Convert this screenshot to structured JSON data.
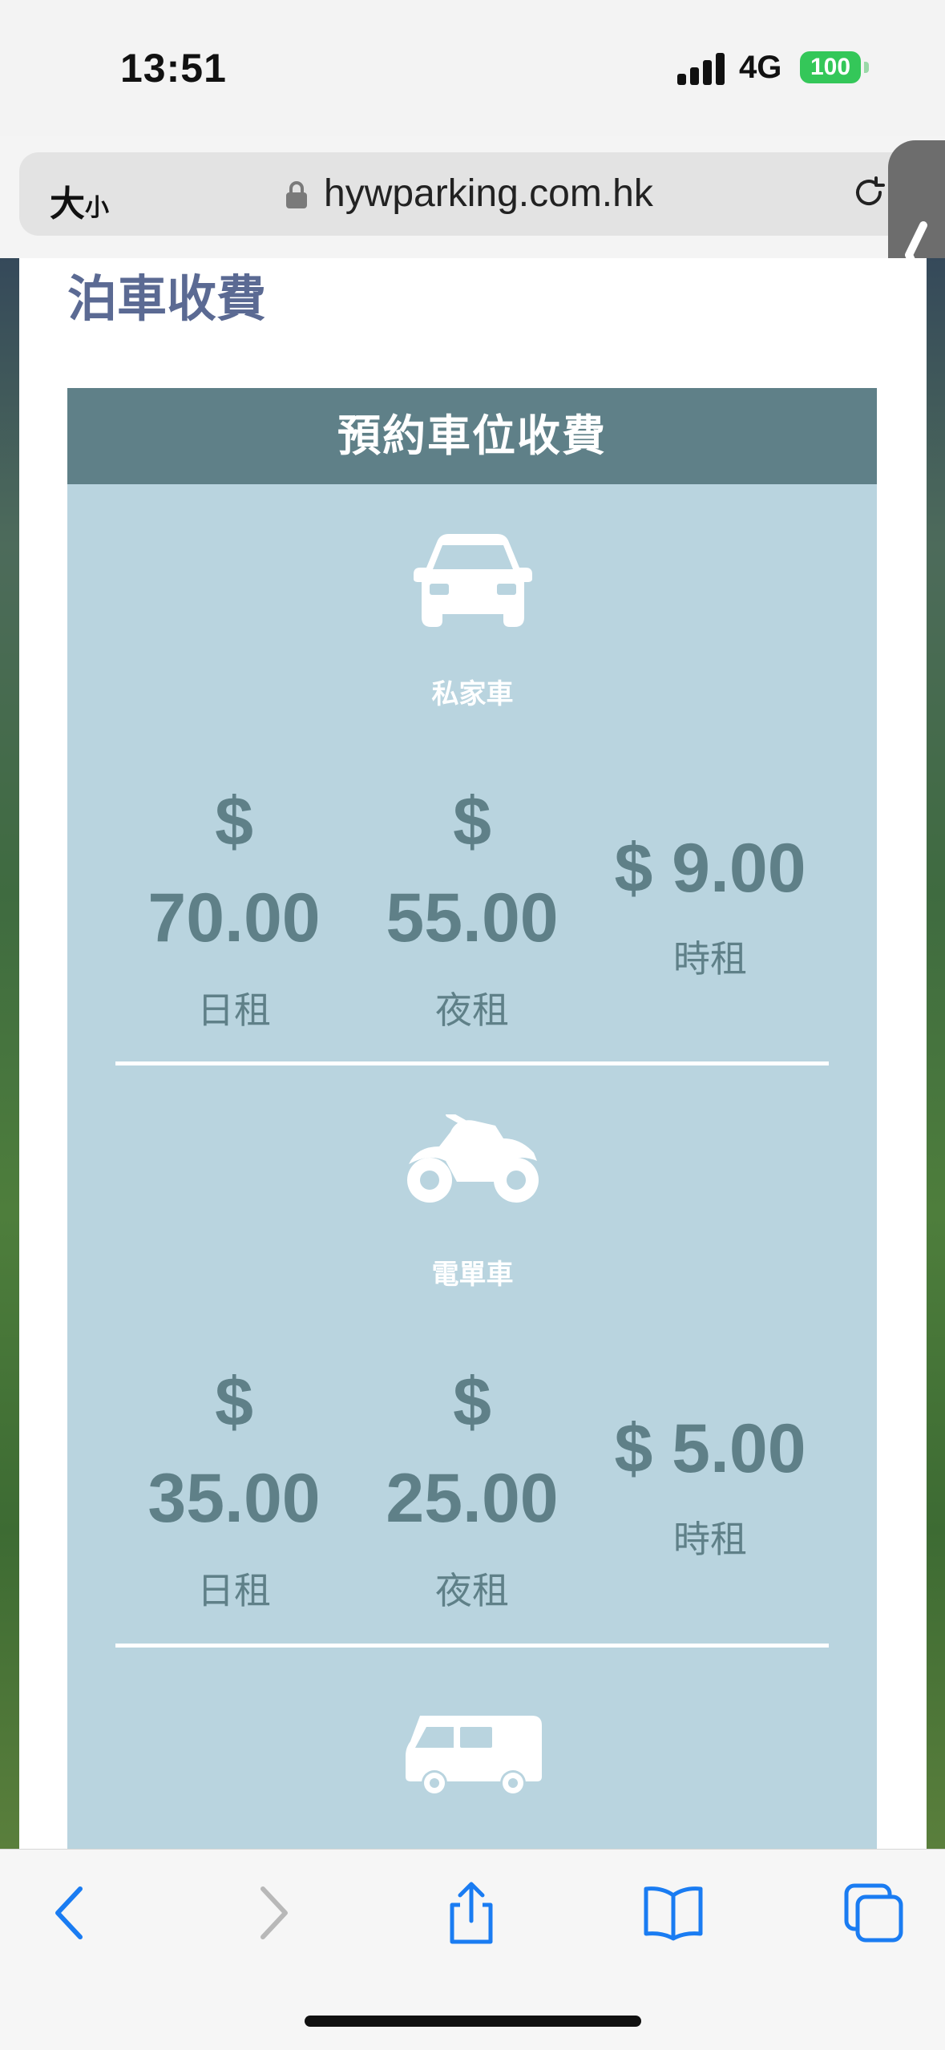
{
  "status_bar": {
    "time": "13:51",
    "network": "4G",
    "battery": "100"
  },
  "browser": {
    "text_size": "大",
    "text_size_small": "小",
    "url": "hywparking.com.hk"
  },
  "page": {
    "title": "泊車收費",
    "card_header": "預約車位收費",
    "vehicles": [
      {
        "name": "私家車",
        "icon": "car-icon",
        "day": {
          "symbol": "$",
          "amount": "70.00",
          "label": "日租"
        },
        "night": {
          "symbol": "$",
          "amount": "55.00",
          "label": "夜租"
        },
        "hourly": {
          "amount": "$ 9.00",
          "label": "時租"
        }
      },
      {
        "name": "電單車",
        "icon": "motorcycle-icon",
        "day": {
          "symbol": "$",
          "amount": "35.00",
          "label": "日租"
        },
        "night": {
          "symbol": "$",
          "amount": "25.00",
          "label": "夜租"
        },
        "hourly": {
          "amount": "$ 5.00",
          "label": "時租"
        }
      },
      {
        "icon": "van-icon"
      }
    ]
  },
  "colors": {
    "accent": "#5f8088",
    "card_bg": "#b9d4df",
    "title": "#5b6a93",
    "ios_blue": "#1a7cf2",
    "battery": "#34c759"
  }
}
